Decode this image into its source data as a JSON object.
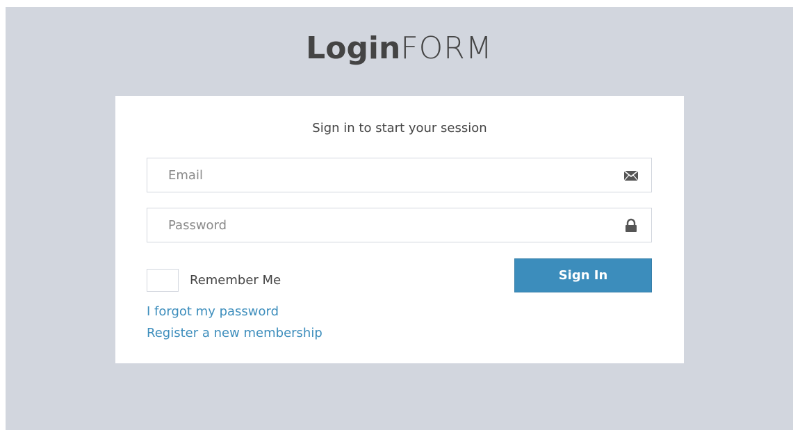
{
  "logo": {
    "bold": "Login",
    "light": "FORM"
  },
  "login_box": {
    "message": "Sign in to start your session",
    "email": {
      "placeholder": "Email",
      "value": "",
      "icon": "envelope-icon"
    },
    "password": {
      "placeholder": "Password",
      "value": "",
      "icon": "lock-icon"
    },
    "remember_label": "Remember Me",
    "remember_checked": false,
    "signin_label": "Sign In",
    "forgot_link": "I forgot my password",
    "register_link": "Register a new membership"
  },
  "colors": {
    "background": "#d2d6de",
    "accent": "#3c8dbc",
    "text": "#444444"
  }
}
